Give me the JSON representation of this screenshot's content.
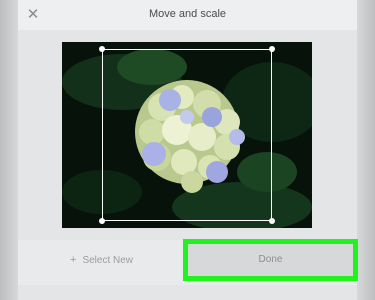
{
  "dialog": {
    "title": "Move and scale",
    "close_icon": "close-icon",
    "close_glyph": "✕"
  },
  "image": {
    "subject": "hydrangea-photo"
  },
  "footer": {
    "select_new_icon": "plus-icon",
    "select_new_glyph": "+",
    "select_new_label": "Select New",
    "done_label": "Done"
  },
  "colors": {
    "highlight": "#22f21d",
    "crop_border": "#ffffff"
  }
}
